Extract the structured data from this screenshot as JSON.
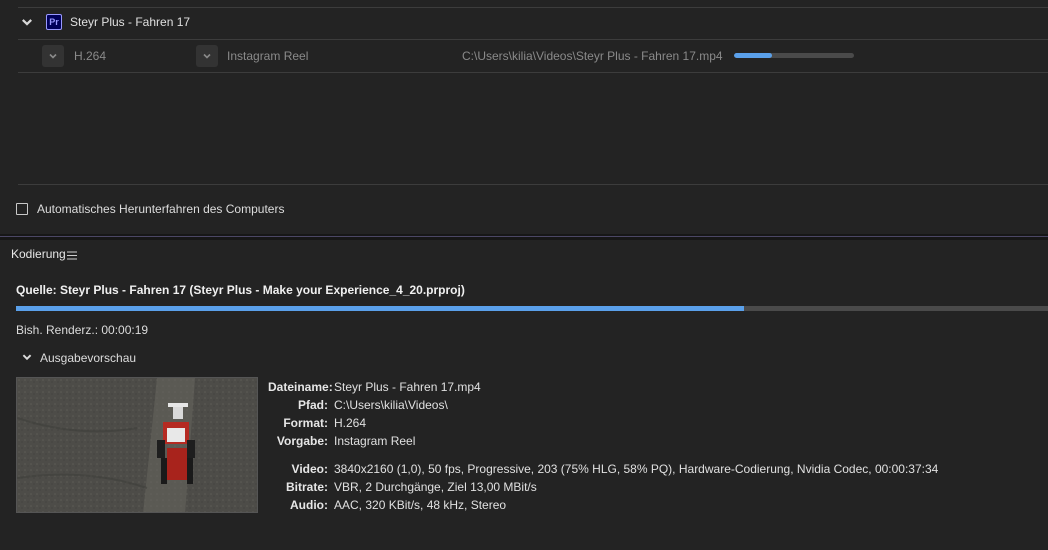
{
  "queue": {
    "item_title": "Steyr Plus - Fahren 17",
    "app_badge": "Pr",
    "output": {
      "format": "H.264",
      "preset": "Instagram Reel",
      "path": "C:\\Users\\kilia\\Videos\\Steyr Plus - Fahren 17.mp4",
      "progress": 0.32
    },
    "shutdown_label": "Automatisches Herunterfahren des Computers",
    "shutdown_checked": false
  },
  "encoding": {
    "panel_title": "Kodierung",
    "source_label": "Quelle: Steyr Plus - Fahren 17 (Steyr Plus - Make your Experience_4_20.prproj)",
    "progress": 0.705,
    "elapsed_label": "Bish. Renderz.: 00:00:19",
    "preview_label": "Ausgabevorschau",
    "details": {
      "filename_label": "Dateiname:",
      "filename": "Steyr Plus - Fahren 17.mp4",
      "path_label": "Pfad:",
      "path": "C:\\Users\\kilia\\Videos\\",
      "format_label": "Format:",
      "format": "H.264",
      "preset_label": "Vorgabe:",
      "preset": "Instagram Reel",
      "video_label": "Video:",
      "video": "3840x2160 (1,0), 50 fps, Progressive, 203 (75% HLG, 58% PQ), Hardware-Codierung, Nvidia Codec, 00:00:37:34",
      "bitrate_label": "Bitrate:",
      "bitrate": "VBR, 2 Durchgänge, Ziel 13,00 MBit/s",
      "audio_label": "Audio:",
      "audio": "AAC, 320 KBit/s, 48 kHz, Stereo"
    }
  },
  "colors": {
    "accent": "#5aa0ea",
    "track": "#4a4a4a",
    "pr_badge_bg": "#00005b",
    "pr_badge_fg": "#9999ff"
  }
}
